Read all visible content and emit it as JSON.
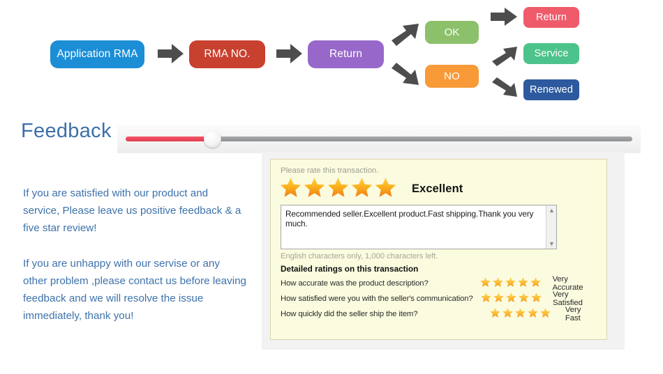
{
  "flow": {
    "nodes": [
      {
        "id": "application-rma",
        "label": "Application RMA",
        "color": "#1b8ed6"
      },
      {
        "id": "rma-no",
        "label": "RMA NO.",
        "color": "#c8412f"
      },
      {
        "id": "return",
        "label": "Return",
        "color": "#9768c9"
      },
      {
        "id": "ok",
        "label": "OK",
        "color": "#8cc06a"
      },
      {
        "id": "no",
        "label": "NO",
        "color": "#f89a38"
      },
      {
        "id": "return-result",
        "label": "Return",
        "color": "#ef5b6a"
      },
      {
        "id": "service",
        "label": "Service",
        "color": "#4cc38a"
      },
      {
        "id": "renewed",
        "label": "Renewed",
        "color": "#2d5a9e"
      }
    ],
    "arrow_color": "#4d4d4d"
  },
  "feedback": {
    "title": "Feedback",
    "title_color": "#3d6fa8",
    "slider": {
      "value_percent": 17,
      "filled_color": "#e8394c",
      "track_color": "#979a9c"
    },
    "notes": [
      "If you are satisfied with our product and service, Please leave us positive feedback & a five star review!",
      "If you are unhappy with our servise or any other problem ,please contact us before leaving feedback and we will resolve the issue immediately, thank you!"
    ],
    "note_color": "#3d72ab"
  },
  "form": {
    "rate_prompt": "Please rate this transaction.",
    "overall_stars": 5,
    "overall_label": "Excellent",
    "review_text": "Recommended seller.Excellent product.Fast shipping.Thank you very much.",
    "chars_left_note": "English characters only, 1,000 characters left.",
    "detailed_title": "Detailed ratings on this transaction",
    "detailed_ratings": [
      {
        "question": "How accurate was the product description?",
        "stars": 5,
        "value": "Very Accurate"
      },
      {
        "question": "How satisfied were you with the seller's communication?",
        "stars": 5,
        "value": "Very Satisfied"
      },
      {
        "question": "How quickly did the seller ship the item?",
        "stars": 5,
        "value": "Very Fast"
      }
    ],
    "panel_bg": "#fbfbdf",
    "star_color": "#f5a623",
    "scroll_up_icon": "▲",
    "scroll_down_icon": "▼"
  }
}
